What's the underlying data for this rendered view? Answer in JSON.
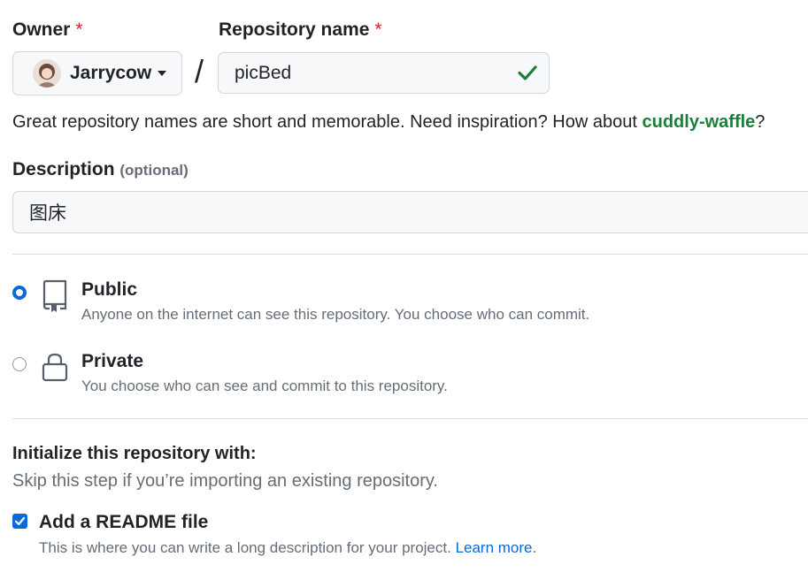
{
  "owner": {
    "label": "Owner",
    "required_mark": "*",
    "name": "Jarrycow"
  },
  "repo": {
    "label": "Repository name",
    "required_mark": "*",
    "value": "picBed",
    "valid": true,
    "separator": "/"
  },
  "name_hint": {
    "text": "Great repository names are short and memorable. Need inspiration? How about ",
    "suggestion": "cuddly-waffle",
    "suffix": "?"
  },
  "description": {
    "label": "Description",
    "optional": "(optional)",
    "value": "图床"
  },
  "visibility": {
    "options": [
      {
        "title": "Public",
        "desc": "Anyone on the internet can see this repository. You choose who can commit.",
        "selected": true,
        "icon": "repo-icon"
      },
      {
        "title": "Private",
        "desc": "You choose who can see and commit to this repository.",
        "selected": false,
        "icon": "lock-icon"
      }
    ]
  },
  "init": {
    "title": "Initialize this repository with:",
    "subtitle": "Skip this step if you’re importing an existing repository.",
    "readme_label": "Add a README file",
    "readme_checked": true,
    "readme_desc": "This is where you can write a long description for your project.",
    "learn_more": "Learn more",
    "learn_more_suffix": "."
  },
  "colors": {
    "accent": "#0969da",
    "success": "#1a7f37",
    "danger": "#cf222e"
  }
}
